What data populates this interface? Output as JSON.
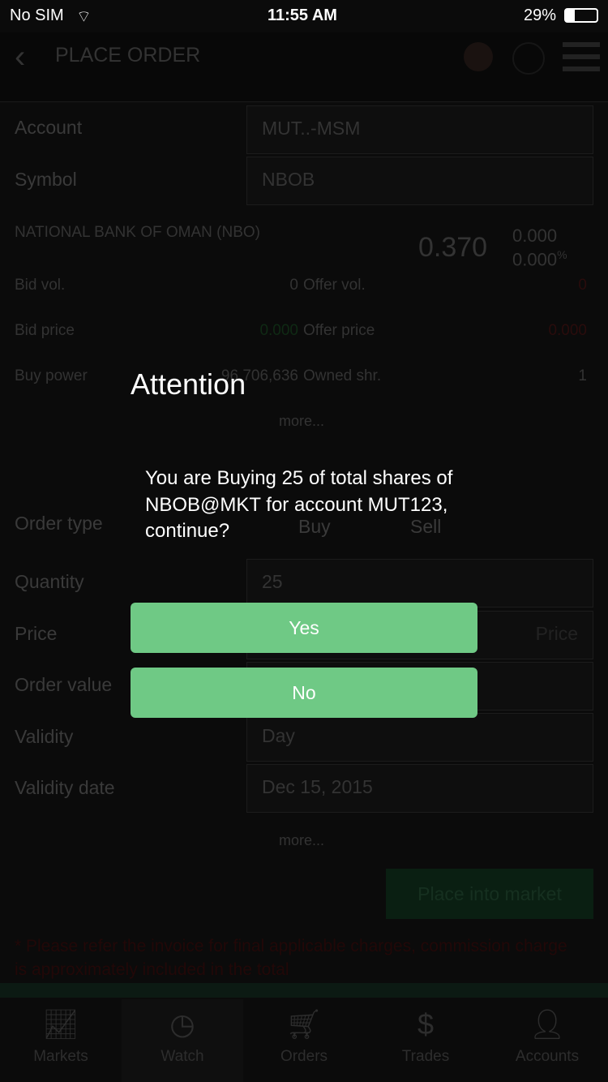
{
  "status": {
    "carrier": "No SIM",
    "time": "11:55 AM",
    "battery": "29%"
  },
  "header": {
    "title": "PLACE ORDER"
  },
  "form": {
    "account_label": "Account",
    "account_value": "MUT..-MSM",
    "symbol_label": "Symbol",
    "symbol_value": "NBOB",
    "company": "NATIONAL BANK OF OMAN (NBO)",
    "price": "0.370",
    "change": "0.000",
    "change_pct": "0.000",
    "pct_sign": "%",
    "bid_vol_label": "Bid vol.",
    "bid_vol": "0",
    "offer_vol_label": "Offer vol.",
    "offer_vol": "0",
    "bid_price_label": "Bid price",
    "bid_price": "0.000",
    "offer_price_label": "Offer price",
    "offer_price": "0.000",
    "buy_power_label": "Buy power",
    "buy_power": "96,706,636",
    "owned_label": "Owned shr.",
    "owned": "1",
    "more1": "more...",
    "order_type_label": "Order type",
    "buy": "Buy",
    "sell": "Sell",
    "quantity_label": "Quantity",
    "quantity": "25",
    "price_label": "Price",
    "price_placeholder": "Price",
    "order_value_label": "Order value",
    "validity_label": "Validity",
    "validity": "Day",
    "validity_date_label": "Validity date",
    "validity_date": "Dec 15, 2015",
    "more2": "more...",
    "place_button": "Place into market",
    "disclaimer": "* Please refer the invoice for final applicable charges, commission charge is approximately included in the total"
  },
  "dialog": {
    "title": "Attention",
    "message": "You are Buying 25 of total shares of NBOB@MKT for account MUT123, continue?",
    "yes": "Yes",
    "no": "No"
  },
  "tabs": [
    {
      "label": "Markets"
    },
    {
      "label": "Watch"
    },
    {
      "label": "Orders"
    },
    {
      "label": "Trades"
    },
    {
      "label": "Accounts"
    }
  ],
  "colors": {
    "accent": "#6fc985",
    "overlay": "#000000"
  }
}
